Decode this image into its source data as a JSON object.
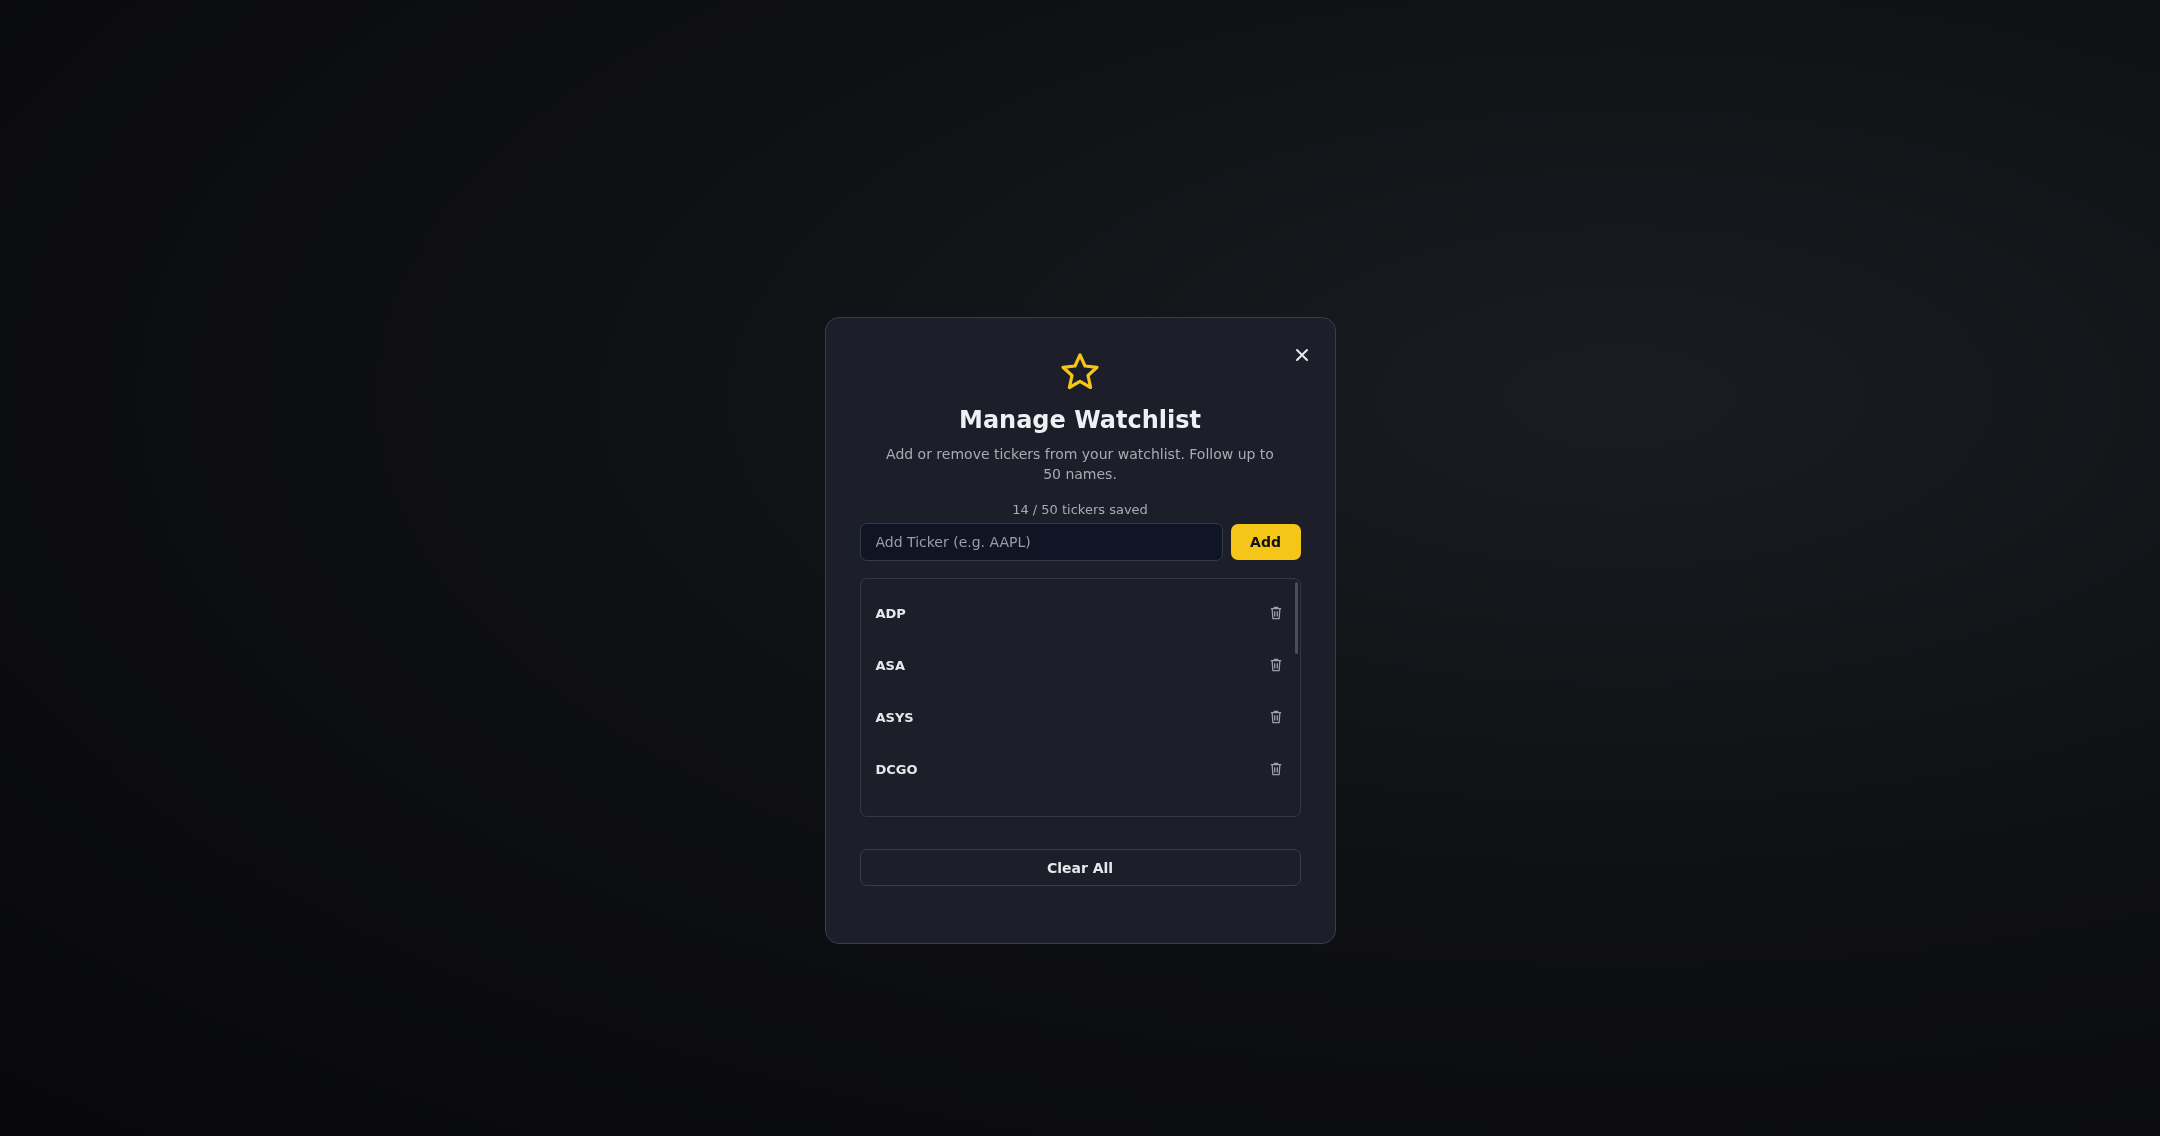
{
  "dialog": {
    "title": "Manage Watchlist",
    "description": "Add or remove tickers from your watchlist. Follow up to 50 names.",
    "count": "14 / 50 tickers saved",
    "ticker_input": {
      "placeholder": "Add Ticker (e.g. AAPL)"
    },
    "add_button": "Add",
    "tickers": [
      {
        "symbol": "ADP"
      },
      {
        "symbol": "ASA"
      },
      {
        "symbol": "ASYS"
      },
      {
        "symbol": "DCGO"
      }
    ],
    "clear_button": "Clear All"
  }
}
